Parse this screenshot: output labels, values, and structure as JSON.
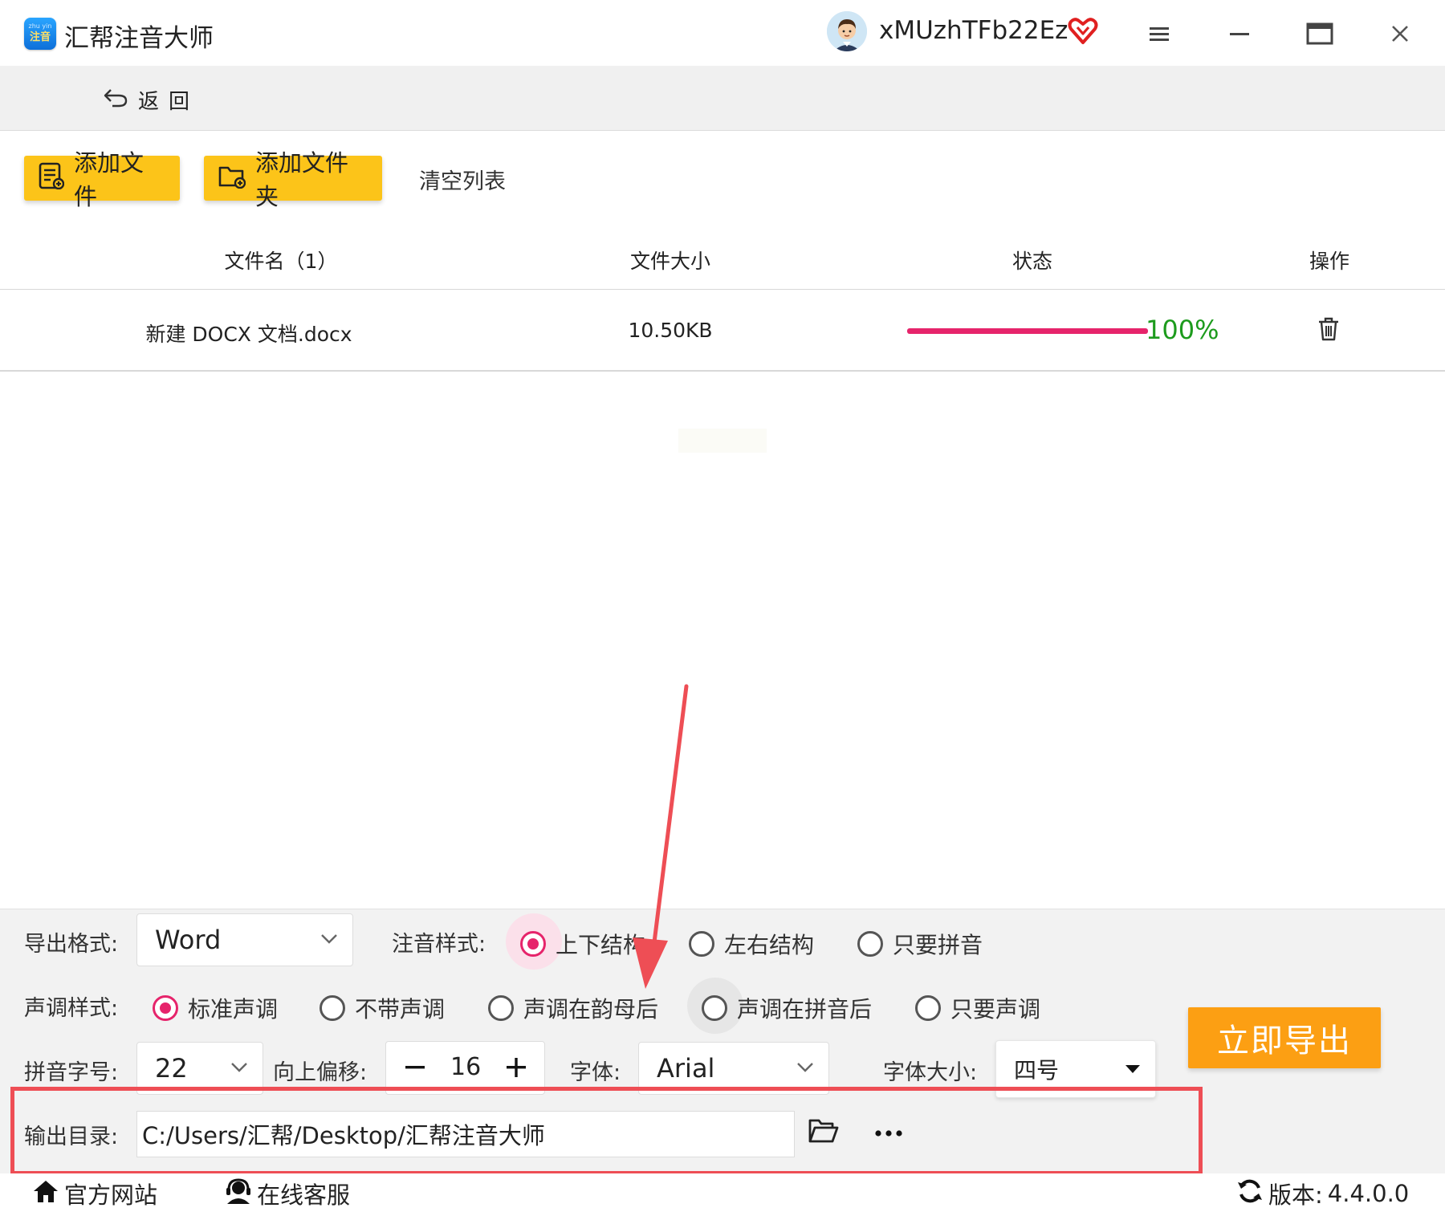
{
  "window": {
    "title": "汇帮注音大师",
    "logo_text_top": "zhu yin",
    "logo_text_main": "注音",
    "username": "xMUzhTFb22Ez"
  },
  "nav": {
    "back_label": "返回"
  },
  "toolbar": {
    "add_file_label": "添加文件",
    "add_folder_label": "添加文件夹",
    "clear_list_label": "清空列表"
  },
  "table": {
    "columns": [
      "文件名（1）",
      "文件大小",
      "状态",
      "操作"
    ],
    "rows": [
      {
        "name": "新建 DOCX 文档.docx",
        "size": "10.50KB",
        "progress": 1.0,
        "progress_text": "100%"
      }
    ]
  },
  "settings": {
    "export_format": {
      "label": "导出格式:",
      "value": "Word"
    },
    "annotation_style": {
      "label": "注音样式:",
      "options": [
        "上下结构",
        "左右结构",
        "只要拼音"
      ],
      "selected": "上下结构"
    },
    "tone_style": {
      "label": "声调样式:",
      "options": [
        "标准声调",
        "不带声调",
        "声调在韵母后",
        "声调在拼音后",
        "只要声调"
      ],
      "selected": "标准声调"
    },
    "pinyin_size": {
      "label": "拼音字号:",
      "value": "22"
    },
    "offset": {
      "label": "向上偏移:",
      "value": "16"
    },
    "font": {
      "label": "字体:",
      "value": "Arial"
    },
    "font_size": {
      "label": "字体大小:",
      "value": "四号"
    },
    "output_dir": {
      "label": "输出目录:",
      "value": "C:/Users/汇帮/Desktop/汇帮注音大师"
    },
    "export_button": "立即导出"
  },
  "footer": {
    "website_label": "官方网站",
    "support_label": "在线客服",
    "version_label": "版本:",
    "version_value": "4.4.0.0"
  },
  "colors": {
    "accent_yellow": "#fcc419",
    "export_orange": "#fc9f13",
    "radio_pink": "#e6246b",
    "progress_pink": "#e6246b",
    "progress_text_green": "#1d9b1d",
    "highlight_red": "#ee4e55"
  },
  "icons": [
    "app-logo",
    "avatar",
    "vip-heart-icon",
    "menu-icon",
    "minimize-icon",
    "maximize-icon",
    "close-icon",
    "back-arrow-icon",
    "add-file-icon",
    "add-folder-icon",
    "trash-icon",
    "chevron-down-icon",
    "caret-down-icon",
    "folder-open-icon",
    "more-icon",
    "home-icon",
    "headset-icon",
    "refresh-icon"
  ]
}
